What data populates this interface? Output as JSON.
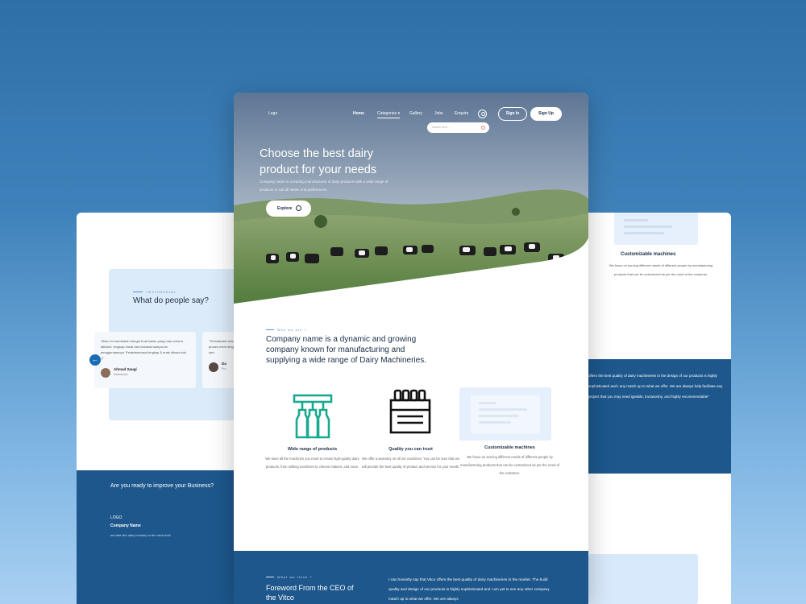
{
  "main": {
    "nav": {
      "logo": "Logo",
      "home": "Home",
      "categories": "Categories",
      "gallery": "Gallery",
      "jobs": "Jobs",
      "enquire": "Enquire",
      "search_placeholder": "Search here...",
      "sign_in": "Sign In",
      "sign_up": "Sign Up"
    },
    "hero": {
      "title": "Choose the best dairy product for your needs",
      "subtitle": "Company name is a leading manufacturer of dairy products with a wide range of products to suit all tastes and preferences.",
      "explore": "Explore"
    },
    "about": {
      "eyebrow": "Who we are ?",
      "heading": "Company name is a dynamic and growing company known for manufacturing and supplying a wide range of Dairy Machineries."
    },
    "features": [
      {
        "icon": "bottling-machine-icon",
        "title": "Wide range of products",
        "desc": "We have all the machines you need to create high-quality dairy products, from milking machines to cheese makers, and more."
      },
      {
        "icon": "milk-crate-icon",
        "title": "Quality you can trust",
        "desc": "We offer a warranty on all our machines. You can be sure that we will provide the best quality of product and service for your needs."
      },
      {
        "icon": "card-placeholder",
        "title": "Customizable machines",
        "desc": "We focus on serving different needs of different people by manufacturing products that can be customized as per the need of the customer."
      }
    ],
    "foreword": {
      "eyebrow": "What we think ?",
      "heading": "Foreword From the CEO of the Vitco",
      "quote": "I can honestly say that Vitco offers the best quality of dairy machineries in the market. The build quality and design of our products is highly sophisticated and I am yet to see any other company match up to what we offer.  We are always"
    }
  },
  "left": {
    "eyebrow": "TESTIMONIAL",
    "heading": "What do people say?",
    "testimonial_1": "\"Buku ini membantu banget buat kalian yang mau coba in tailwind. lengkap mulai dari instalasi sampai ke penggunaannya. Penjelasannya lengkap & enak dibaca kok :)\"",
    "author_1": "Ahmad Saugi",
    "role_1": "Mahasiswa",
    "testimonial_2": "\"Terimakasih membantu proses mem lengkap dan",
    "author_2": "Da",
    "role_2": "Pro",
    "cta": "Are you ready to improve your Business?",
    "footer_logo": "LOGO",
    "footer_company": "Company Name",
    "footer_tagline": "we take the dairy industry to the next level"
  },
  "right": {
    "title": "Customizable machines",
    "desc": "We focus on serving different needs of different people by manufacturing products that can be customized as per the need of the customer.",
    "quote": "offers the best quality of dairy machineries in the design of our products is highly sophisticated and I any match up to what we offer.  We are always help facilitate any project that you may need igeable, trustworthy, and highly recommendable\""
  },
  "colors": {
    "navy": "#1d578c",
    "accent_blue": "#1a6db4",
    "pale_blue": "#dcebfa",
    "teal_icon": "#1aa98f"
  }
}
